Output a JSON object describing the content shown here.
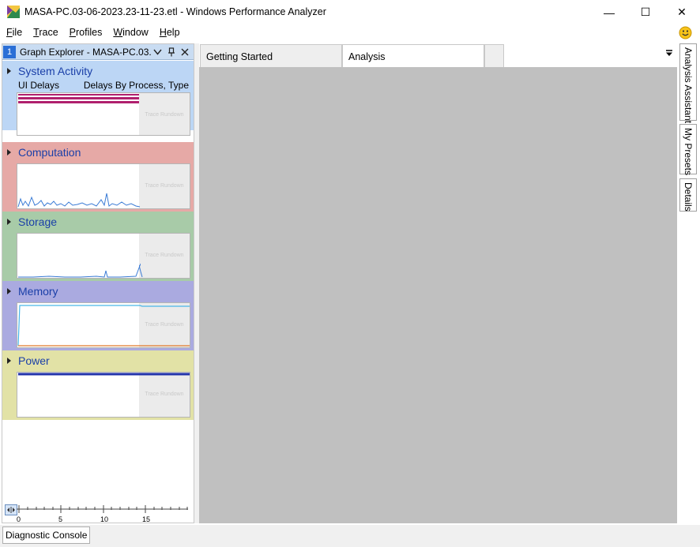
{
  "window": {
    "title": "MASA-PC.03-06-2023.23-11-23.etl - Windows Performance Analyzer",
    "minimize_glyph": "—",
    "maximize_glyph": "☐",
    "close_glyph": "✕"
  },
  "menu": [
    {
      "accel": "F",
      "rest": "ile"
    },
    {
      "accel": "T",
      "rest": "race"
    },
    {
      "accel": "P",
      "rest": "rofiles"
    },
    {
      "accel": "W",
      "rest": "indow"
    },
    {
      "accel": "H",
      "rest": "elp"
    }
  ],
  "graph_explorer": {
    "number": "1",
    "title": "Graph Explorer - MASA-PC.03...",
    "groups": [
      {
        "name": "System Activity",
        "color": "#bcd6f5"
      },
      {
        "name": "Computation",
        "color": "#e6a9a6"
      },
      {
        "name": "Storage",
        "color": "#a8cba8"
      },
      {
        "name": "Memory",
        "color": "#aaaae0"
      },
      {
        "name": "Power",
        "color": "#e2e2a6"
      }
    ],
    "system_activity_left_label": "UI Delays",
    "system_activity_right_label": "Delays By Process, Type",
    "thumbnail_overlay_text": "Trace Rundown",
    "axis_ticks": [
      "0",
      "5",
      "10",
      "15"
    ]
  },
  "tabs": [
    {
      "label": "Getting Started",
      "active": false
    },
    {
      "label": "Analysis",
      "active": true
    },
    {
      "label": "",
      "active": false
    }
  ],
  "side_tabs": [
    "Analysis Assistant",
    "My Presets",
    "Details"
  ],
  "status": {
    "diagnostic_console": "Diagnostic Console"
  },
  "colors": {
    "delays_bar": "#b0206e",
    "series_line": "#3a7bd5",
    "memory_line": "#49b6e8",
    "memory_base": "#e07a2a",
    "power_line": "#2233aa",
    "workspace": "#c0c0c0"
  }
}
